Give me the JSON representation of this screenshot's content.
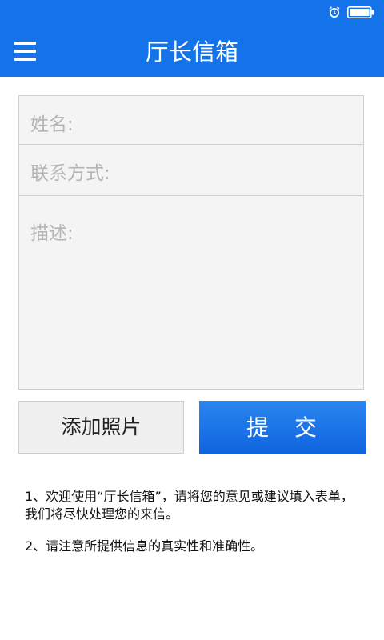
{
  "statusbar": {
    "alarm_icon": "alarm-icon",
    "battery_icon": "battery-icon"
  },
  "appbar": {
    "menu_icon": "menu-icon",
    "title": "厅长信箱",
    "color": "#1473e8"
  },
  "form": {
    "name_placeholder": "姓名:",
    "contact_placeholder": "联系方式:",
    "description_placeholder": "描述:"
  },
  "actions": {
    "add_photo_label": "添加照片",
    "submit_label": "提　交"
  },
  "notes": {
    "line1": "1、欢迎使用“厅长信箱”，请将您的意见或建议填入表单，我们将尽快处理您的来信。",
    "line2": "2、请注意所提供信息的真实性和准确性。"
  }
}
